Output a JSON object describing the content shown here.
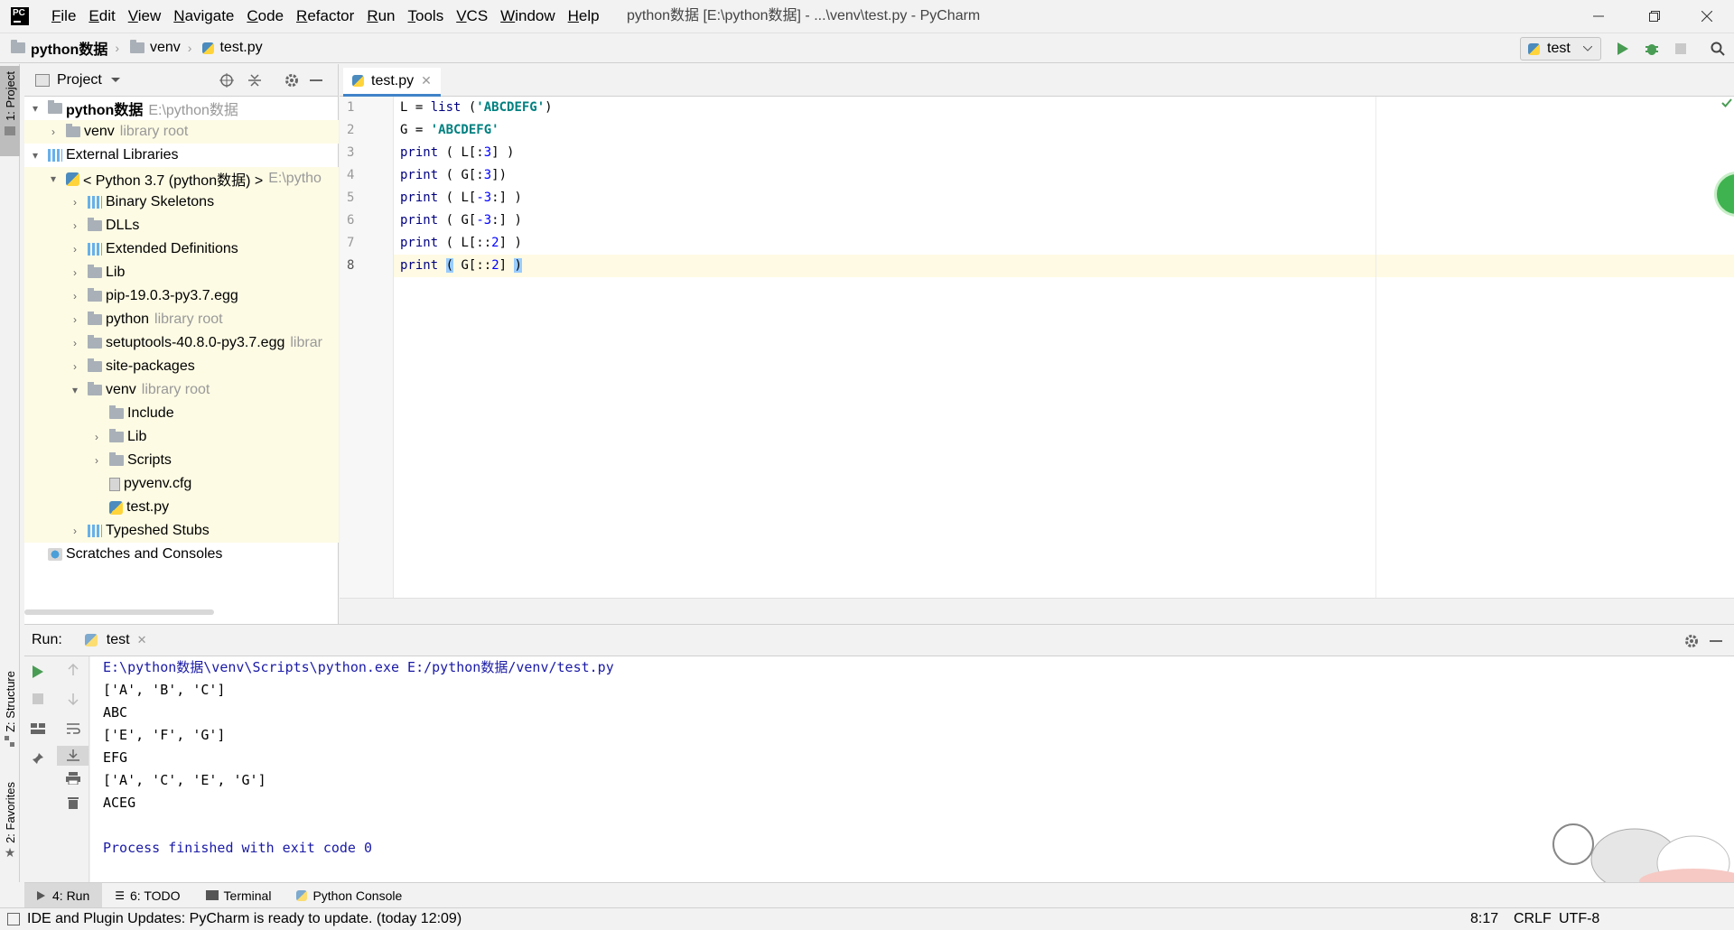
{
  "titlebar": {
    "menu": [
      "File",
      "Edit",
      "View",
      "Navigate",
      "Code",
      "Refactor",
      "Run",
      "Tools",
      "VCS",
      "Window",
      "Help"
    ],
    "window_title": "python数据 [E:\\python数据] - ...\\venv\\test.py - PyCharm"
  },
  "navbar": {
    "crumbs": [
      "python数据",
      "venv",
      "test.py"
    ],
    "run_config": "test"
  },
  "left_stripe": {
    "project_tab": "1: Project",
    "structure_tab": "Z: Structure",
    "favorites_tab": "2: Favorites"
  },
  "project_panel": {
    "title": "Project",
    "tree": [
      {
        "label": "python数据",
        "hint": "E:\\python数据"
      },
      {
        "label": "venv",
        "hint": "library root"
      },
      {
        "label": "External Libraries",
        "hint": ""
      },
      {
        "label": "< Python 3.7 (python数据) >",
        "hint": "E:\\pytho"
      },
      {
        "label": "Binary Skeletons",
        "hint": ""
      },
      {
        "label": "DLLs",
        "hint": ""
      },
      {
        "label": "Extended Definitions",
        "hint": ""
      },
      {
        "label": "Lib",
        "hint": ""
      },
      {
        "label": "pip-19.0.3-py3.7.egg",
        "hint": ""
      },
      {
        "label": "python",
        "hint": "library root"
      },
      {
        "label": "setuptools-40.8.0-py3.7.egg",
        "hint": "librar"
      },
      {
        "label": "site-packages",
        "hint": ""
      },
      {
        "label": "venv",
        "hint": "library root"
      },
      {
        "label": "Include",
        "hint": ""
      },
      {
        "label": "Lib",
        "hint": ""
      },
      {
        "label": "Scripts",
        "hint": ""
      },
      {
        "label": "pyvenv.cfg",
        "hint": ""
      },
      {
        "label": "test.py",
        "hint": ""
      },
      {
        "label": "Typeshed Stubs",
        "hint": ""
      },
      {
        "label": "Scratches and Consoles",
        "hint": ""
      }
    ]
  },
  "editor": {
    "tab": "test.py",
    "line_numbers": [
      "1",
      "2",
      "3",
      "4",
      "5",
      "6",
      "7",
      "8"
    ],
    "lines": [
      "L = list ('ABCDEFG')",
      "G = 'ABCDEFG'",
      "print ( L[:3] )",
      "print ( G[:3])",
      "print ( L[-3:] )",
      "print ( G[-3:] )",
      "print ( L[::2] )",
      "print ( G[::2] )"
    ]
  },
  "run_panel": {
    "label": "Run:",
    "tab": "test",
    "console": [
      "E:\\python数据\\venv\\Scripts\\python.exe E:/python数据/venv/test.py",
      "['A', 'B', 'C']",
      "ABC",
      "['E', 'F', 'G']",
      "EFG",
      "['A', 'C', 'E', 'G']",
      "ACEG",
      "",
      "Process finished with exit code 0"
    ]
  },
  "bottom_tabs": [
    "4: Run",
    "6: TODO",
    "Terminal",
    "Python Console"
  ],
  "statusbar": {
    "message": "IDE and Plugin Updates: PyCharm is ready to update. (today 12:09)",
    "position": "8:17",
    "line_sep": "CRLF",
    "encoding": "UTF-8"
  },
  "colors": {
    "keyword": "#000080",
    "string": "#008080",
    "number": "#0000ff",
    "console_blue": "#1a1aa6",
    "run_green": "#499c54"
  }
}
